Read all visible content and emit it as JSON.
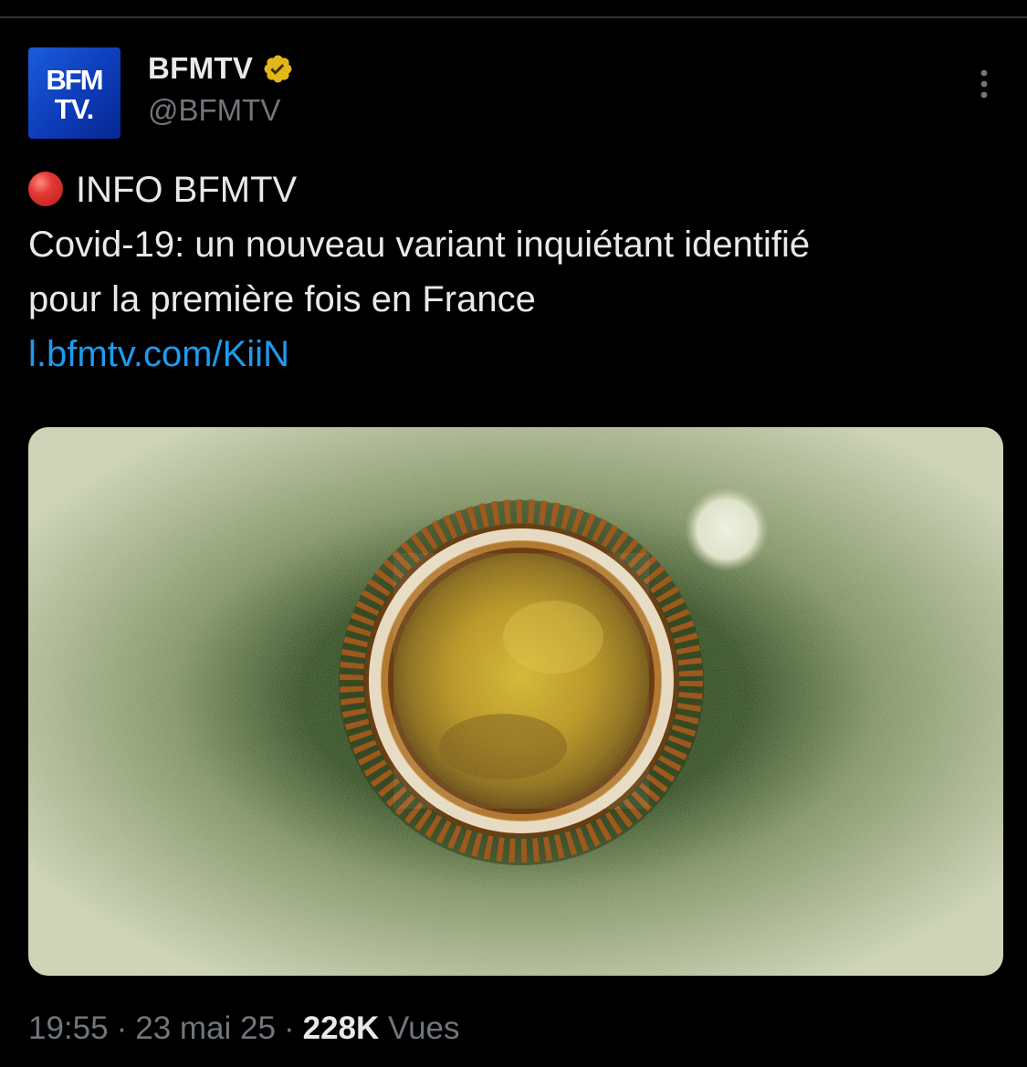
{
  "colors": {
    "background": "#000000",
    "text_primary": "#e7e9ea",
    "text_secondary": "#71767b",
    "link": "#1d9bf0",
    "verified_badge": "#e2b719",
    "avatar_blue": "#0d3bb8",
    "live_dot": "#e53935"
  },
  "author": {
    "avatar_text_line1": "BFM",
    "avatar_text_line2": "TV.",
    "display_name": "BFMTV",
    "handle": "@BFMTV",
    "verified_icon": "gold-verified-check-icon"
  },
  "menu": {
    "icon": "more-vertical-icon"
  },
  "tweet": {
    "live_icon": "red-circle-emoji",
    "line1": "INFO BFMTV",
    "line2": "Covid-19: un nouveau variant inquiétant identifié",
    "line3": "pour la première fois en France",
    "link": "l.bfmtv.com/KiiN"
  },
  "media": {
    "kind": "coronavirus-microscope-image"
  },
  "meta": {
    "time": "19:55",
    "separator": "·",
    "date": "23 mai 25",
    "views_count": "228K",
    "views_label": "Vues"
  }
}
